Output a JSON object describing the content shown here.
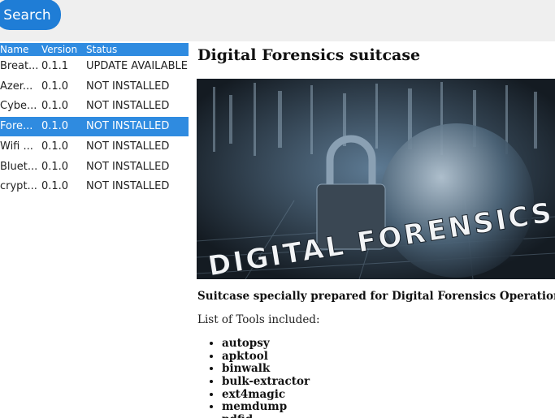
{
  "search": {
    "label": "Search"
  },
  "table": {
    "headers": {
      "name": "Name",
      "version": "Version",
      "status": "Status"
    },
    "rows": [
      {
        "name": "Breat...",
        "version": "0.1.1",
        "status": "UPDATE AVAILABLE",
        "selected": false
      },
      {
        "name": "Azer...",
        "version": "0.1.0",
        "status": "NOT INSTALLED",
        "selected": false
      },
      {
        "name": "Cybe...",
        "version": "0.1.0",
        "status": "NOT INSTALLED",
        "selected": false
      },
      {
        "name": "Fore...",
        "version": "0.1.0",
        "status": "NOT INSTALLED",
        "selected": true
      },
      {
        "name": "Wifi ...",
        "version": "0.1.0",
        "status": "NOT INSTALLED",
        "selected": false
      },
      {
        "name": "Bluet...",
        "version": "0.1.0",
        "status": "NOT INSTALLED",
        "selected": false
      },
      {
        "name": "crypt...",
        "version": "0.1.0",
        "status": "NOT INSTALLED",
        "selected": false
      }
    ]
  },
  "detail": {
    "title": "Digital Forensics suitcase",
    "image_text": "DIGITAL FORENSICS",
    "description": "Suitcase specially prepared for Digital Forensics Operations",
    "tools_heading": "List of Tools included:",
    "tools": [
      "autopsy",
      "apktool",
      "binwalk",
      "bulk-extractor",
      "ext4magic",
      "memdump",
      "pdfid"
    ]
  },
  "colors": {
    "accent": "#2f8be0",
    "button": "#1f7dd6"
  }
}
